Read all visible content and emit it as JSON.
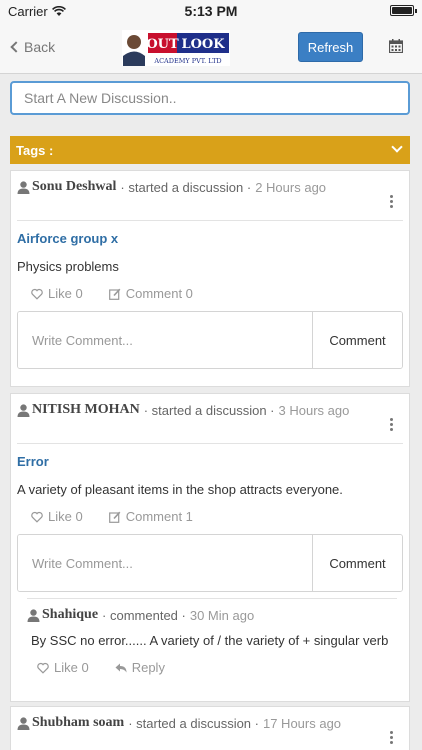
{
  "status": {
    "carrier": "Carrier",
    "time": "5:13 PM"
  },
  "nav": {
    "back_label": "Back",
    "refresh_label": "Refresh"
  },
  "brand": {
    "logo_out": "OUT",
    "logo_look": "LOOK",
    "logo_sub": "ACADEMY PVT. LTD"
  },
  "composer": {
    "placeholder": "Start A New Discussion.."
  },
  "tags": {
    "label": "Tags :"
  },
  "comment_placeholder": "Write Comment...",
  "comment_button": "Comment",
  "posts": [
    {
      "author": "Sonu Deshwal",
      "action": "· started a discussion ·",
      "time": "2 Hours ago",
      "title": "Airforce group x",
      "body": "Physics problems",
      "like_label": "Like 0",
      "comment_label": "Comment 0"
    },
    {
      "author": "NITISH MOHAN",
      "action": "· started a discussion ·",
      "time": "3 Hours ago",
      "title": "Error",
      "body": "A variety of pleasant items in the shop attracts everyone.",
      "like_label": "Like 0",
      "comment_label": "Comment 1",
      "reply": {
        "author": "Shahique",
        "action": "· commented ·",
        "time": "30 Min ago",
        "text": "By SSC no error...... A variety of / the variety of + singular verb",
        "like_label": "Like 0",
        "reply_label": "Reply"
      }
    },
    {
      "author": "Shubham soam",
      "action": "· started a discussion ·",
      "time": "17 Hours ago"
    }
  ]
}
